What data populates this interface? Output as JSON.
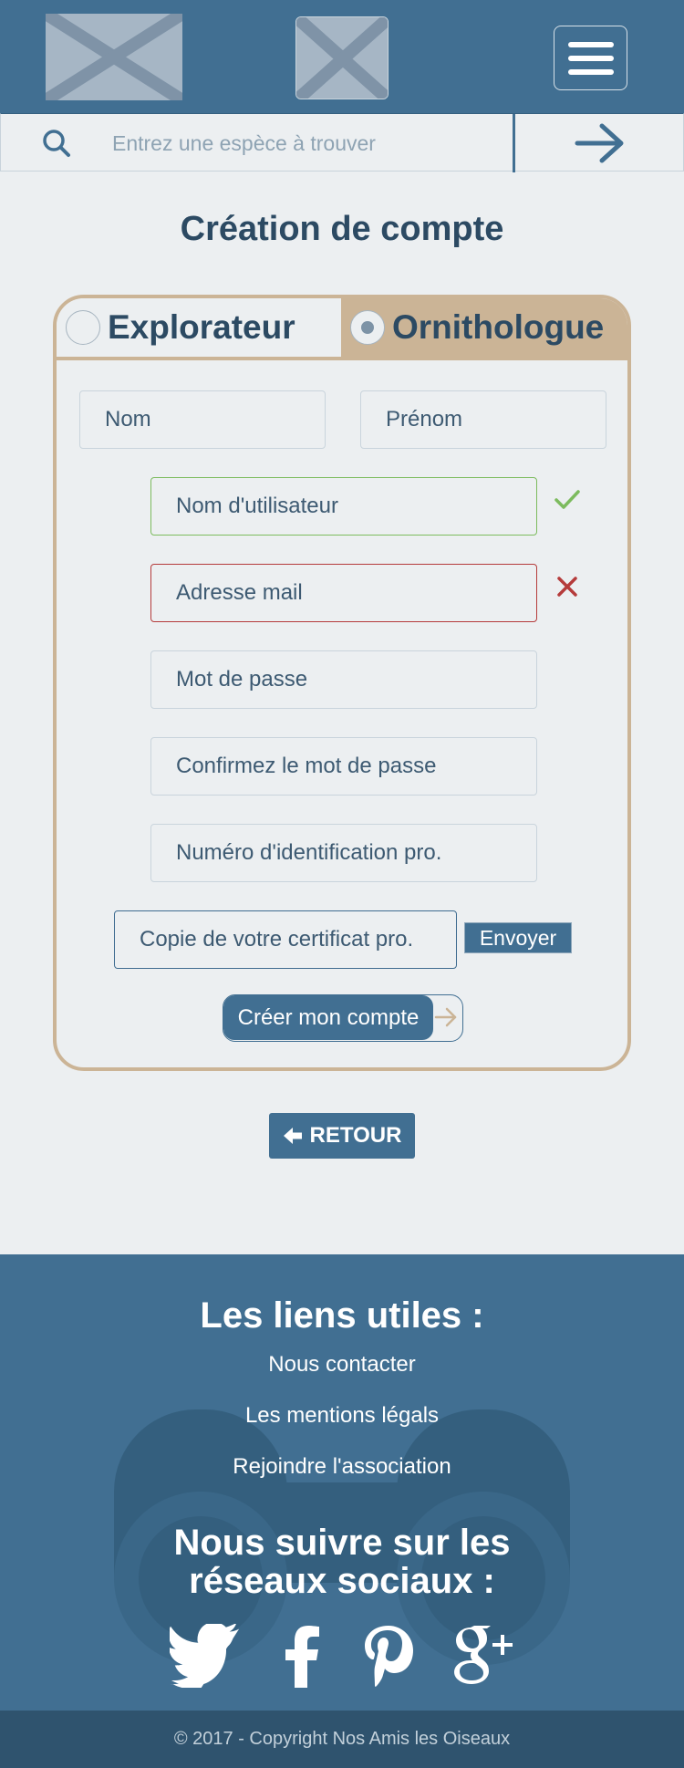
{
  "header": {
    "logo_alt": "",
    "menu_icon": "hamburger-menu-icon"
  },
  "search": {
    "placeholder": "Entrez une espèce à trouver",
    "icon": "search-icon",
    "submit_icon": "arrow-right-icon"
  },
  "page": {
    "title": "Création de compte"
  },
  "form": {
    "tabs": [
      {
        "label": "Explorateur",
        "selected": false
      },
      {
        "label": "Ornithologue",
        "selected": true
      }
    ],
    "fields": {
      "nom": "Nom",
      "prenom": "Prénom",
      "username": "Nom d'utilisateur",
      "email": "Adresse mail",
      "password": "Mot de passe",
      "password_confirm": "Confirmez le mot de passe",
      "pro_id": "Numéro d'identification pro.",
      "certificate": "Copie de votre certificat pro."
    },
    "send_label": "Envoyer",
    "submit_label": "Créer mon compte",
    "validation": {
      "username": "valid",
      "email": "invalid"
    },
    "colors": {
      "valid": "#7cbb5e",
      "invalid": "#b53b3b",
      "accent": "#cbb496",
      "primary": "#416f92"
    }
  },
  "back": {
    "label": "RETOUR",
    "icon": "arrow-left-icon"
  },
  "footer": {
    "links_title": "Les liens utiles :",
    "links": [
      "Nous contacter",
      "Les mentions légals",
      "Rejoindre l'association"
    ],
    "social_title_line1": "Nous suivre sur les",
    "social_title_line2": "réseaux sociaux :",
    "social": [
      "twitter-icon",
      "facebook-icon",
      "pinterest-icon",
      "google-plus-icon"
    ],
    "copyright": "© 2017 - Copyright Nos Amis les Oiseaux"
  }
}
